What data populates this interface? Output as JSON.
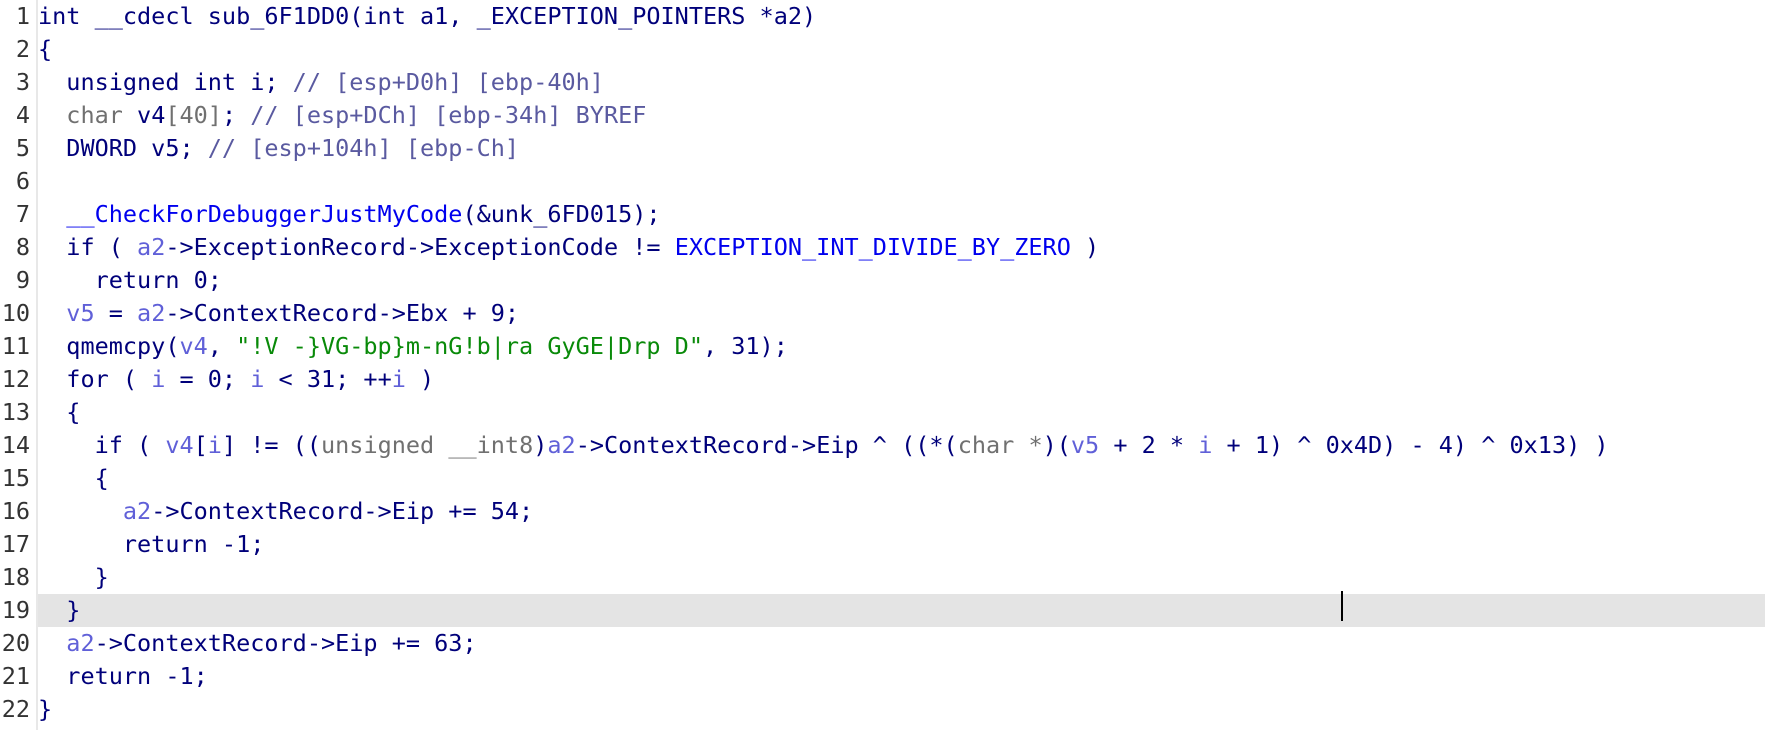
{
  "editor": {
    "lines": [
      {
        "n": "1",
        "tokens": [
          [
            "k",
            "int __cdecl sub_6F1DD0(int a1, _EXCEPTION_POINTERS *a2)"
          ]
        ]
      },
      {
        "n": "2",
        "tokens": [
          [
            "k",
            "{"
          ]
        ]
      },
      {
        "n": "3",
        "tokens": [
          [
            "k",
            "  unsigned int i; "
          ],
          [
            "c",
            "// [esp+D0h] [ebp-40h]"
          ]
        ]
      },
      {
        "n": "4",
        "tokens": [
          [
            "gy",
            "  char "
          ],
          [
            "k",
            "v4"
          ],
          [
            "gy",
            "[40]"
          ],
          [
            "k",
            "; "
          ],
          [
            "c",
            "// [esp+DCh] [ebp-34h] BYREF"
          ]
        ]
      },
      {
        "n": "5",
        "tokens": [
          [
            "k",
            "  DWORD v5; "
          ],
          [
            "c",
            "// [esp+104h] [ebp-Ch]"
          ]
        ]
      },
      {
        "n": "6",
        "tokens": [
          [
            "k",
            ""
          ]
        ]
      },
      {
        "n": "7",
        "tokens": [
          [
            "k",
            "  "
          ],
          [
            "cst",
            "__CheckForDebuggerJustMyCode"
          ],
          [
            "k",
            "(&unk_6FD015);"
          ]
        ]
      },
      {
        "n": "8",
        "tokens": [
          [
            "k",
            "  if ( "
          ],
          [
            "v",
            "a2"
          ],
          [
            "k",
            "->ExceptionRecord->ExceptionCode != "
          ],
          [
            "cst",
            "EXCEPTION_INT_DIVIDE_BY_ZERO"
          ],
          [
            "k",
            " )"
          ]
        ]
      },
      {
        "n": "9",
        "tokens": [
          [
            "k",
            "    return 0;"
          ]
        ]
      },
      {
        "n": "10",
        "tokens": [
          [
            "k",
            "  "
          ],
          [
            "v",
            "v5"
          ],
          [
            "k",
            " = "
          ],
          [
            "v",
            "a2"
          ],
          [
            "k",
            "->ContextRecord->Ebx + 9;"
          ]
        ]
      },
      {
        "n": "11",
        "tokens": [
          [
            "k",
            "  qmemcpy("
          ],
          [
            "v",
            "v4"
          ],
          [
            "k",
            ", "
          ],
          [
            "s",
            "\"!V -}VG-bp}m-nG!b|ra GyGE|Drp D\""
          ],
          [
            "k",
            ", 31);"
          ]
        ]
      },
      {
        "n": "12",
        "tokens": [
          [
            "k",
            "  for ( "
          ],
          [
            "v",
            "i"
          ],
          [
            "k",
            " = 0; "
          ],
          [
            "v",
            "i"
          ],
          [
            "k",
            " < 31; ++"
          ],
          [
            "v",
            "i"
          ],
          [
            "k",
            " )"
          ]
        ]
      },
      {
        "n": "13",
        "tokens": [
          [
            "k",
            "  {"
          ]
        ]
      },
      {
        "n": "14",
        "tokens": [
          [
            "k",
            "    if ( "
          ],
          [
            "v",
            "v4"
          ],
          [
            "k",
            "["
          ],
          [
            "v",
            "i"
          ],
          [
            "k",
            "] != (("
          ],
          [
            "gy",
            "unsigned __int8"
          ],
          [
            "k",
            ")"
          ],
          [
            "v",
            "a2"
          ],
          [
            "k",
            "->ContextRecord->Eip ^ ((*("
          ],
          [
            "gy",
            "char *"
          ],
          [
            "k",
            ")("
          ],
          [
            "v",
            "v5"
          ],
          [
            "k",
            " + 2 * "
          ],
          [
            "v",
            "i"
          ],
          [
            "k",
            " + 1) ^ 0x4D) - 4) ^ 0x13) )"
          ]
        ]
      },
      {
        "n": "15",
        "tokens": [
          [
            "k",
            "    {"
          ]
        ]
      },
      {
        "n": "16",
        "tokens": [
          [
            "k",
            "      "
          ],
          [
            "v",
            "a2"
          ],
          [
            "k",
            "->ContextRecord->Eip += 54;"
          ]
        ]
      },
      {
        "n": "17",
        "tokens": [
          [
            "k",
            "      return -1;"
          ]
        ]
      },
      {
        "n": "18",
        "tokens": [
          [
            "k",
            "    }"
          ]
        ]
      },
      {
        "n": "19",
        "tokens": [
          [
            "k",
            "  }"
          ]
        ],
        "current": true
      },
      {
        "n": "20",
        "tokens": [
          [
            "k",
            "  "
          ],
          [
            "v",
            "a2"
          ],
          [
            "k",
            "->ContextRecord->Eip += 63;"
          ]
        ]
      },
      {
        "n": "21",
        "tokens": [
          [
            "k",
            "  return -1;"
          ]
        ]
      },
      {
        "n": "22",
        "tokens": [
          [
            "k",
            "}"
          ]
        ]
      }
    ]
  },
  "colors": {
    "keyword": "#00007a",
    "variable": "#6060d8",
    "comment": "#5a5aa0",
    "string": "#098a09",
    "constant": "#0000ee",
    "type": "#707070",
    "current_line": "#e4e4e4"
  }
}
